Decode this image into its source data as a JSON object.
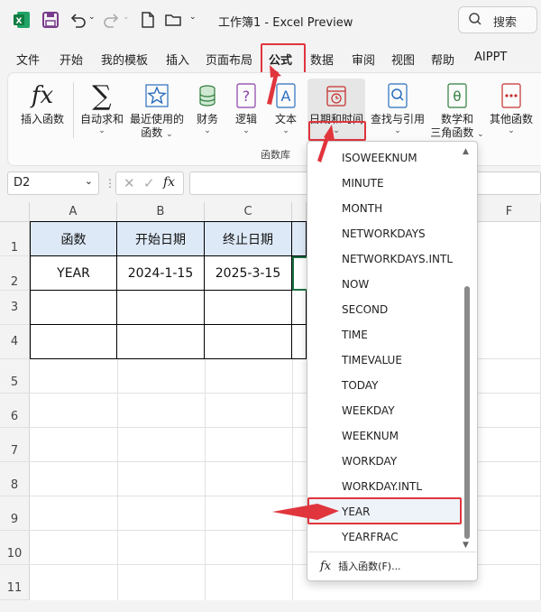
{
  "window": {
    "title": "工作簿1  -  Excel Preview",
    "search_label": "搜索"
  },
  "menu": {
    "items": [
      "文件",
      "开始",
      "我的模板",
      "插入",
      "页面布局",
      "公式",
      "数据",
      "审阅",
      "视图",
      "帮助",
      "AIPPT"
    ],
    "active": "公式"
  },
  "ribbon": {
    "buttons": {
      "insert_function": "插入函数",
      "autosum": "自动求和",
      "recent_l1": "最近使用的",
      "recent_l2": "函数",
      "financial": "财务",
      "logical": "逻辑",
      "text": "文本",
      "datetime": "日期和时间",
      "lookup": "查找与引用",
      "math_l1": "数学和",
      "math_l2": "三角函数",
      "other": "其他函数"
    },
    "group_label": "函数库"
  },
  "formula_bar": {
    "name_box": "D2",
    "fx": "fx",
    "value": ""
  },
  "sheet": {
    "columns": [
      "A",
      "B",
      "C",
      "F"
    ],
    "rows": [
      "1",
      "2",
      "3",
      "4",
      "5",
      "6",
      "7",
      "8",
      "9",
      "10",
      "11"
    ],
    "cells": {
      "A1": "函数",
      "B1": "开始日期",
      "C1": "终止日期",
      "A2": "YEAR",
      "B2": "2024-1-15",
      "C2": "2025-3-15"
    }
  },
  "dropdown": {
    "items": [
      "ISOWEEKNUM",
      "MINUTE",
      "MONTH",
      "NETWORKDAYS",
      "NETWORKDAYS.INTL",
      "NOW",
      "SECOND",
      "TIME",
      "TIMEVALUE",
      "TODAY",
      "WEEKDAY",
      "WEEKNUM",
      "WORKDAY",
      "WORKDAY.INTL",
      "YEAR",
      "YEARFRAC"
    ],
    "highlighted": "YEAR",
    "footer": "插入函数(F)..."
  },
  "colors": {
    "accent_red": "#e0353d",
    "header_fill": "#dde9f7",
    "excel_green": "#1e7145"
  }
}
